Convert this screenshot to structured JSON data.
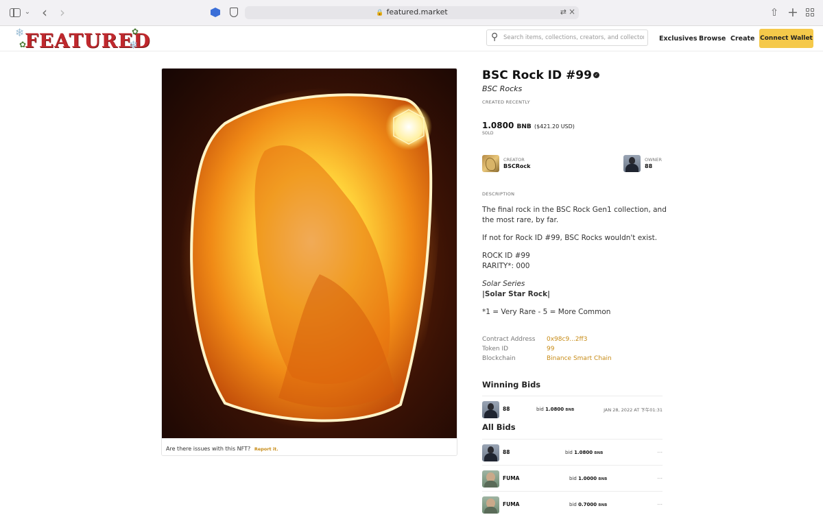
{
  "browser": {
    "url": "featured.market",
    "icons": [
      "sidebar-icon",
      "chevron-down-icon",
      "back-icon",
      "forward-icon",
      "extension-icon",
      "shield-icon",
      "lock-icon",
      "translate-icon",
      "close-icon",
      "share-icon",
      "plus-icon",
      "tabs-grid-icon"
    ]
  },
  "header": {
    "logo": "FEATURED",
    "search_placeholder": "Search items, collections, creators, and collectors",
    "nav": [
      "Exclusives",
      "Browse",
      "Create"
    ],
    "connect_label": "Connect Wallet",
    "accent": "#f5c94a"
  },
  "nft": {
    "issue_text": "Are there issues with this NFT?",
    "report_label": "Report it.",
    "title": "BSC Rock ID #99",
    "collection": "BSC Rocks",
    "created": "CREATED RECENTLY",
    "price": "1.0800",
    "price_unit": "BNB",
    "price_usd": "($421.20 USD)",
    "status": "SOLD",
    "creator_label": "CREATOR",
    "creator_name": "BSCRock",
    "owner_label": "OWNER",
    "owner_name": "88",
    "description_label": "DESCRIPTION",
    "description": [
      "The final rock in the BSC Rock Gen1 collection, and",
      "the most rare, by far.",
      "If not for Rock ID #99, BSC Rocks wouldn't exist.",
      "ROCK ID #99",
      "RARITY*: 000",
      "Solar Series",
      "|Solar Star Rock|",
      "*1 = Very Rare - 5 = More Common"
    ],
    "meta": [
      {
        "key": "Contract Address",
        "value": "0x98c9...2ff3"
      },
      {
        "key": "Token ID",
        "value": "99"
      },
      {
        "key": "Blockchain",
        "value": "Binance Smart Chain"
      }
    ],
    "link_color": "#c78b16"
  },
  "winning_bids": {
    "title": "Winning Bids",
    "rows": [
      {
        "name": "88",
        "bid_prefix": "bid",
        "amount": "1.0800",
        "unit": "BNB",
        "date": "JAN 28, 2022 AT 下午01:31"
      }
    ]
  },
  "all_bids": {
    "title": "All Bids",
    "rows": [
      {
        "name": "88",
        "bid_prefix": "bid",
        "amount": "1.0800",
        "unit": "BNB",
        "more": "..."
      },
      {
        "name": "FUMA",
        "bid_prefix": "bid",
        "amount": "1.0000",
        "unit": "BNB",
        "more": "..."
      },
      {
        "name": "FUMA",
        "bid_prefix": "bid",
        "amount": "0.7000",
        "unit": "BNB",
        "more": "..."
      }
    ]
  }
}
